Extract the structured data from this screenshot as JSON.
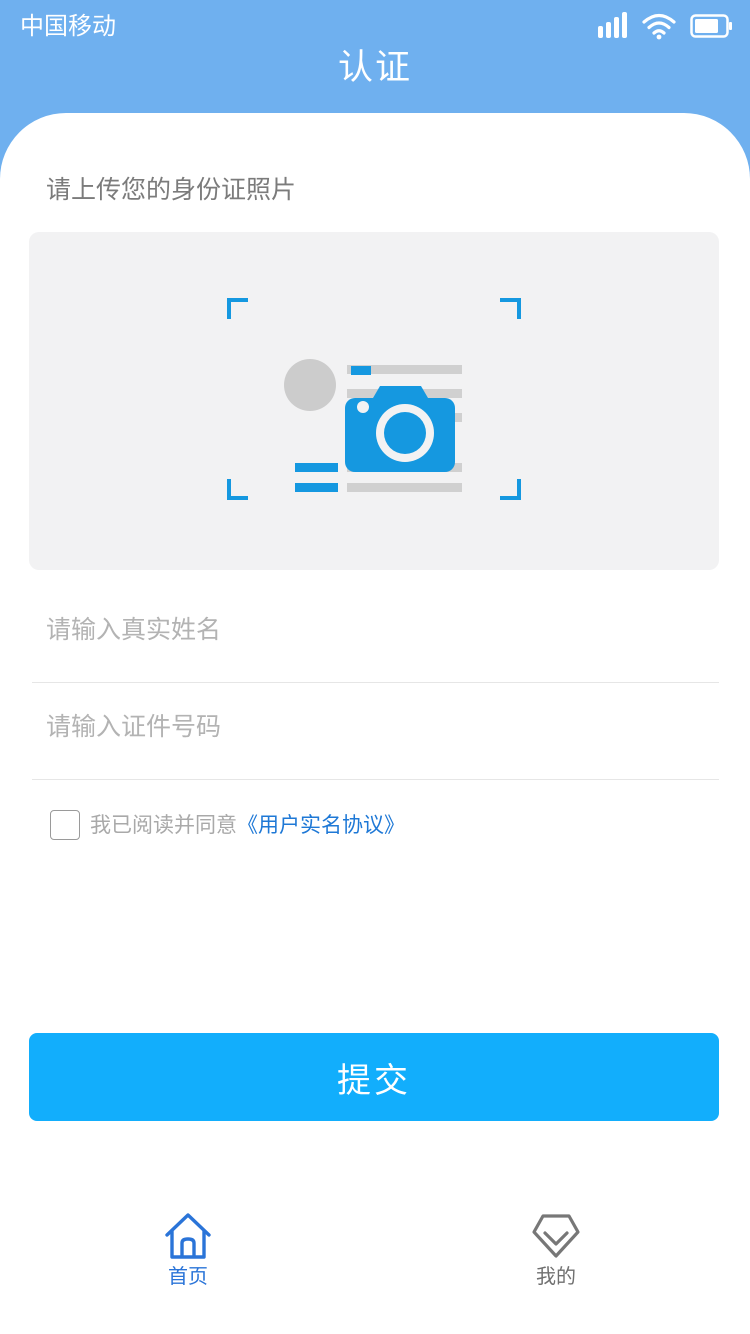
{
  "status_bar": {
    "carrier": "中国移动"
  },
  "header": {
    "title": "认证"
  },
  "upload": {
    "title": "请上传您的身份证照片"
  },
  "form": {
    "name_placeholder": "请输入真实姓名",
    "id_placeholder": "请输入证件号码"
  },
  "agreement": {
    "text": "我已阅读并同意",
    "link": "《用户实名协议》",
    "checked": false
  },
  "submit": {
    "label": "提交"
  },
  "tabs": [
    {
      "label": "首页",
      "icon": "home-icon",
      "active": true
    },
    {
      "label": "我的",
      "icon": "diamond-check-icon",
      "active": false
    }
  ],
  "colors": {
    "header": "#6fb0ef",
    "primary_button": "#12aefc",
    "link": "#1e78d6",
    "camera": "#1598e0",
    "active_tab": "#2a74d8"
  }
}
